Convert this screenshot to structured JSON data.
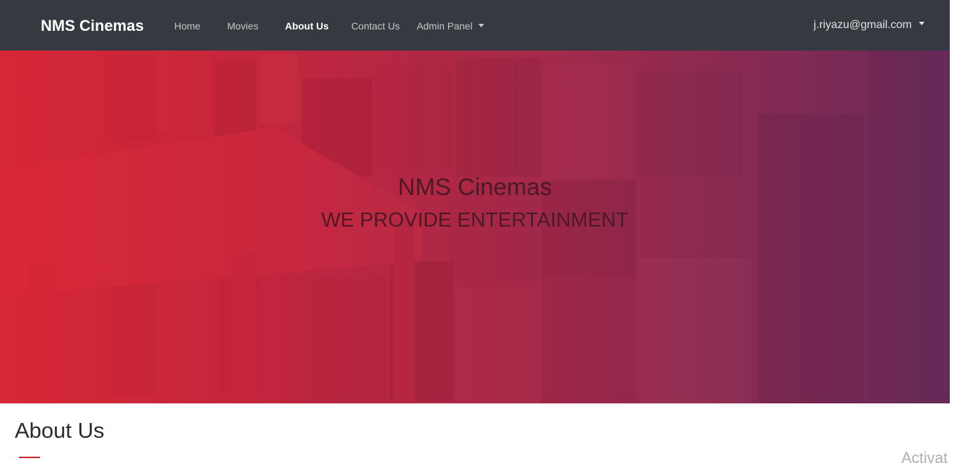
{
  "navbar": {
    "brand": "NMS Cinemas",
    "links": [
      "Home",
      "Movies",
      "About Us",
      "Contact Us"
    ],
    "admin_label": "Admin Panel",
    "user_email": "j.riyazu@gmail.com"
  },
  "hero": {
    "title": "NMS Cinemas",
    "subtitle": "WE PROVIDE ENTERTAINMENT"
  },
  "about": {
    "heading": "About Us"
  },
  "watermark": "Activat",
  "colors": {
    "navbar_bg": "#343a40",
    "hero_red": "#de2634",
    "hero_purple": "#682a5c",
    "accent_underline": "#c8202a"
  }
}
